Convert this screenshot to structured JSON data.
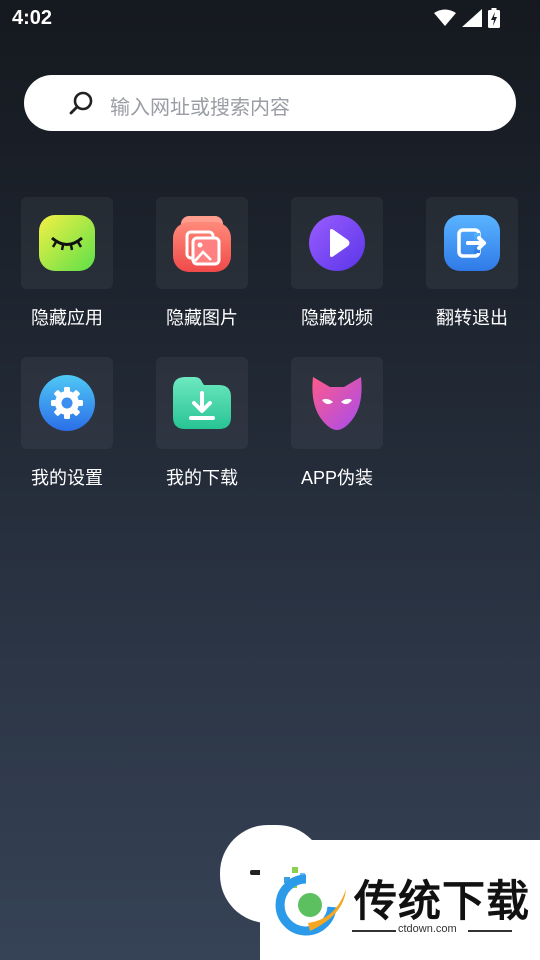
{
  "status": {
    "time": "4:02"
  },
  "search": {
    "placeholder": "输入网址或搜索内容"
  },
  "apps": [
    {
      "label": "隐藏应用",
      "icon": "closed-eye-icon"
    },
    {
      "label": "隐藏图片",
      "icon": "gallery-icon"
    },
    {
      "label": "隐藏视频",
      "icon": "play-icon"
    },
    {
      "label": "翻转退出",
      "icon": "exit-icon"
    },
    {
      "label": "我的设置",
      "icon": "gear-icon"
    },
    {
      "label": "我的下载",
      "icon": "download-folder-icon"
    },
    {
      "label": "APP伪装",
      "icon": "mask-icon"
    }
  ],
  "watermark": {
    "brand": "传统下载",
    "url": "ctdown.com"
  },
  "colors": {
    "eye": "#b8f03c",
    "gallery": "#f25a5a",
    "video": "#7a4cf0",
    "exit": "#2f8cf0",
    "gear": "#2f8cf0",
    "download": "#3ed0a0",
    "mask": "#e0489c"
  }
}
